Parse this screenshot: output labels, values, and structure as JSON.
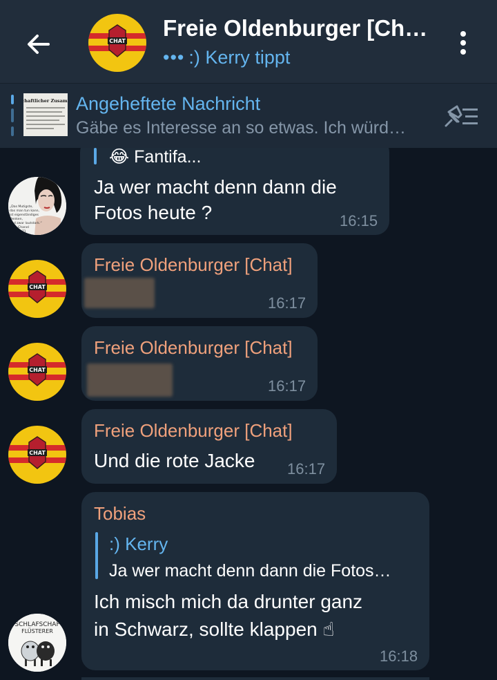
{
  "header": {
    "title": "Freie Oldenburger [Ch…",
    "typing_dots": "•••",
    "typing_text": ":) Kerry tippt",
    "back_icon": "arrow-left-icon",
    "menu_icon": "more-vertical-icon",
    "logo_text": "CHAT"
  },
  "pinned": {
    "title": "Angeheftete Nachricht",
    "text": "Gäbe es Interesse an so etwas. Ich würd…",
    "thumb_caption": "ellschaftlicher Zusammen",
    "list_icon": "pinned-list-icon"
  },
  "colors": {
    "background": "#0e1621",
    "header": "#212d3b",
    "bubble": "#1e2c3a",
    "sender": "#f0a17c",
    "accent": "#64b5ef"
  },
  "messages": [
    {
      "reply_snippet": "😂 Fantifa...",
      "lines": [
        "Ja wer macht denn dann die",
        "Fotos heute ?"
      ],
      "time": "16:15",
      "avatar_quote": "„Das Mutigste, das man tun kann, ist eigenständiges Denken, und zwar lautstark.“ Chanel 1971"
    },
    {
      "sender": "Freie Oldenburger [Chat]",
      "time": "16:17",
      "avatar_text": "CHAT"
    },
    {
      "sender": "Freie Oldenburger [Chat]",
      "time": "16:17",
      "avatar_text": "CHAT"
    },
    {
      "sender": "Freie Oldenburger [Chat]",
      "text": "Und die rote Jacke",
      "time": "16:17",
      "avatar_text": "CHAT"
    },
    {
      "sender": "Tobias",
      "reply_name": ":) Kerry",
      "reply_text": "Ja wer macht denn dann die Fotos…",
      "lines": [
        "Ich misch mich da drunter ganz",
        "in Schwarz, sollte klappen ☝"
      ],
      "time": "16:18",
      "avatar_text_1": "SCHLAFSCHAF",
      "avatar_text_2": "FLÜSTERER"
    }
  ]
}
